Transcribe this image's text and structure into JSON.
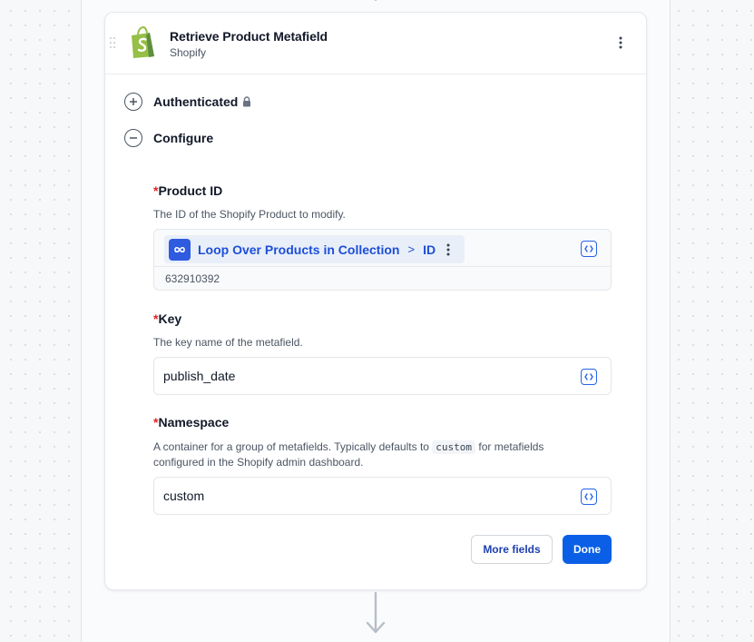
{
  "step": {
    "title": "Retrieve Product Metafield",
    "subtitle": "Shopify",
    "icon": "shopify-logo-icon"
  },
  "sections": {
    "authenticated": "Authenticated",
    "configure": "Configure"
  },
  "fields": {
    "product_id": {
      "required_mark": "*",
      "label": "Product ID",
      "description": "The ID of the Shopify Product to modify.",
      "reference": {
        "step_name": "Loop Over Products in Collection",
        "separator": ">",
        "field": "ID"
      },
      "resolved_value": "632910392"
    },
    "key": {
      "required_mark": "*",
      "label": "Key",
      "description": "The key name of the metafield.",
      "value": "publish_date"
    },
    "namespace": {
      "required_mark": "*",
      "label": "Namespace",
      "description_before": "A container for a group of metafields. Typically defaults to",
      "description_code": "custom",
      "description_after": "for metafields configured in the Shopify admin dashboard.",
      "value": "custom"
    }
  },
  "buttons": {
    "more_fields": "More fields",
    "done": "Done"
  },
  "colors": {
    "accent": "#0a5fe6",
    "required": "#dc2626",
    "shopify_green": "#95bf47"
  }
}
